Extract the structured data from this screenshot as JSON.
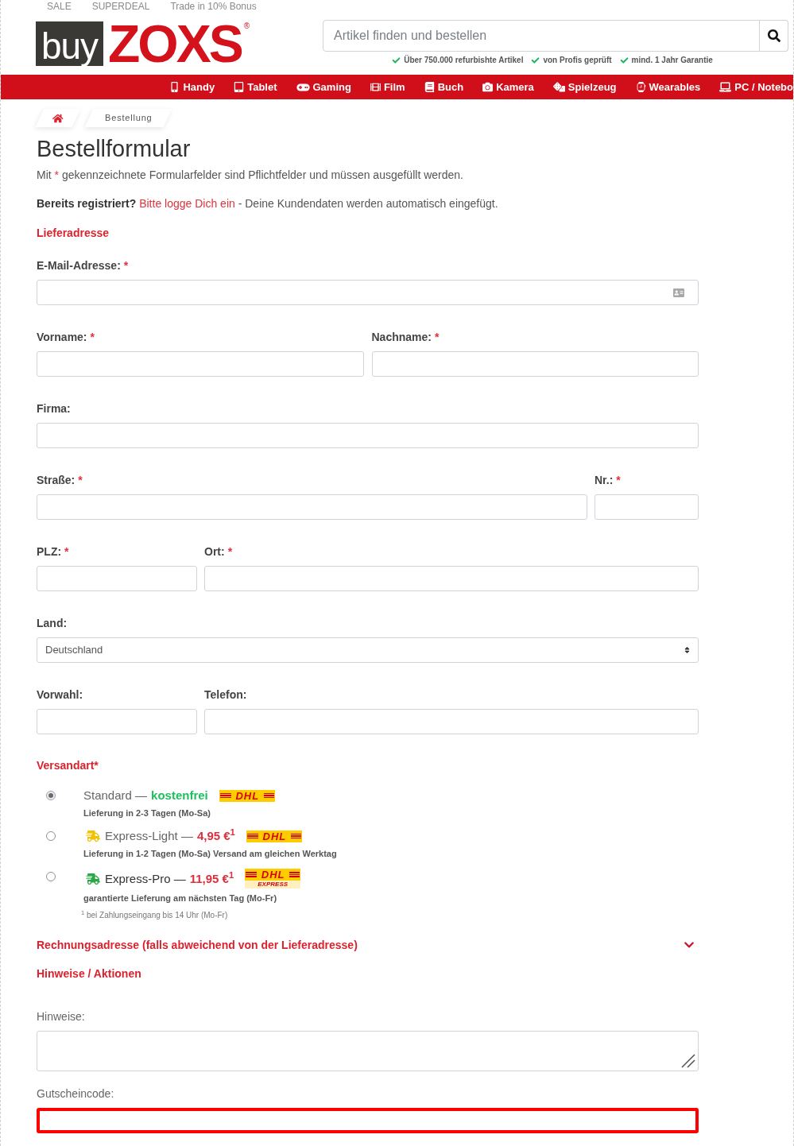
{
  "top_links": [
    "SALE",
    "SUPERDEAL",
    "Trade in 10% Bonus"
  ],
  "logo": {
    "left": "buy",
    "right": "ZOXS",
    "mark": "®"
  },
  "search": {
    "placeholder": "Artikel finden und bestellen"
  },
  "usps": [
    "Über 750.000 refurbishte Artikel",
    "von Profis geprüft",
    "mind. 1 Jahr Garantie"
  ],
  "nav": [
    "Handy",
    "Tablet",
    "Gaming",
    "Film",
    "Buch",
    "Kamera",
    "Spielzeug",
    "Wearables",
    "PC / Notebo"
  ],
  "breadcrumb": [
    "Bestellung"
  ],
  "title": "Bestellformular",
  "intro": {
    "before": "Mit",
    "mark": "*",
    "after": "gekennzeichnete Formularfelder sind Pflichtfelder und müssen ausgefüllt werden."
  },
  "login_note": {
    "lead": "Bereits registriert?",
    "link": "Bitte logge Dich ein",
    "rest": "- Deine Kundendaten werden automatisch eingefügt."
  },
  "address": {
    "heading": "Lieferadresse",
    "rows": [
      {
        "kind": "full",
        "fields": [
          {
            "kind": "text",
            "label": "E-Mail-Adresse:",
            "mark": "*",
            "autofill": true
          }
        ]
      },
      {
        "kind": "halves",
        "fields": [
          {
            "kind": "text",
            "label": "Vorname:",
            "mark": "*",
            "autofill": false
          },
          {
            "kind": "text",
            "label": "Nachname:",
            "mark": "*",
            "autofill": false
          }
        ]
      },
      {
        "kind": "full",
        "fields": [
          {
            "kind": "text",
            "label": "Firma:",
            "autofill": false
          }
        ]
      },
      {
        "kind": "wide_narrow",
        "fields": [
          {
            "kind": "text",
            "label": "Straße:",
            "mark": "*",
            "autofill": false
          },
          {
            "kind": "text",
            "label": "Nr.:",
            "mark": "*",
            "autofill": false
          }
        ]
      },
      {
        "kind": "narrow_wide",
        "fields": [
          {
            "kind": "text",
            "label": "PLZ:",
            "mark": "*",
            "autofill": false
          },
          {
            "kind": "text",
            "label": "Ort:",
            "mark": "*",
            "autofill": false
          }
        ]
      },
      {
        "kind": "full",
        "fields": [
          {
            "kind": "select",
            "label": "Land:",
            "value": "Deutschland",
            "autofill": false
          }
        ]
      },
      {
        "kind": "narrow_wide",
        "fields": [
          {
            "kind": "text",
            "label": "Vorwahl:",
            "autofill": false
          },
          {
            "kind": "text",
            "label": "Telefon:",
            "autofill": false
          }
        ]
      }
    ]
  },
  "shipping": {
    "heading": "Versandart*",
    "options": [
      {
        "kind": "standard",
        "selected": true,
        "name": "Standard",
        "separator": "—",
        "price": "kostenfrei",
        "carrier": "DHL",
        "detail": "Lieferung in 2-3 Tagen (Mo-Sa)"
      },
      {
        "kind": "express_light",
        "selected": false,
        "name": "Express-Light",
        "separator": "—",
        "price": "4,95 €$^{1}$",
        "carrier": "DHL",
        "detail": "Lieferung in 1-2 Tagen (Mo-Sa) Versand am gleichen Werktag"
      },
      {
        "kind": "express_pro",
        "selected": false,
        "name": "Express-Pro",
        "separator": "—",
        "price": "11,95 €$^{1}$",
        "carrier": "DHL",
        "carrier_sub": "EXPRESS",
        "detail": "garantierte Lieferung am nächsten Tag (Mo-Fr)"
      }
    ],
    "footnote": "$^{1}$ bei Zahlungseingang bis 14 Uhr (Mo-Fr)"
  },
  "billing": {
    "label": "Rechnungsadresse (falls abweichend von der Lieferadresse)",
    "expanded": false
  },
  "notes": {
    "heading": "Hinweise / Aktionen",
    "fields": [
      {
        "kind": "textarea",
        "label": "Hinweise:",
        "highlighted": false
      },
      {
        "kind": "text",
        "label": "Gutscheincode:",
        "highlighted": true
      }
    ]
  }
}
